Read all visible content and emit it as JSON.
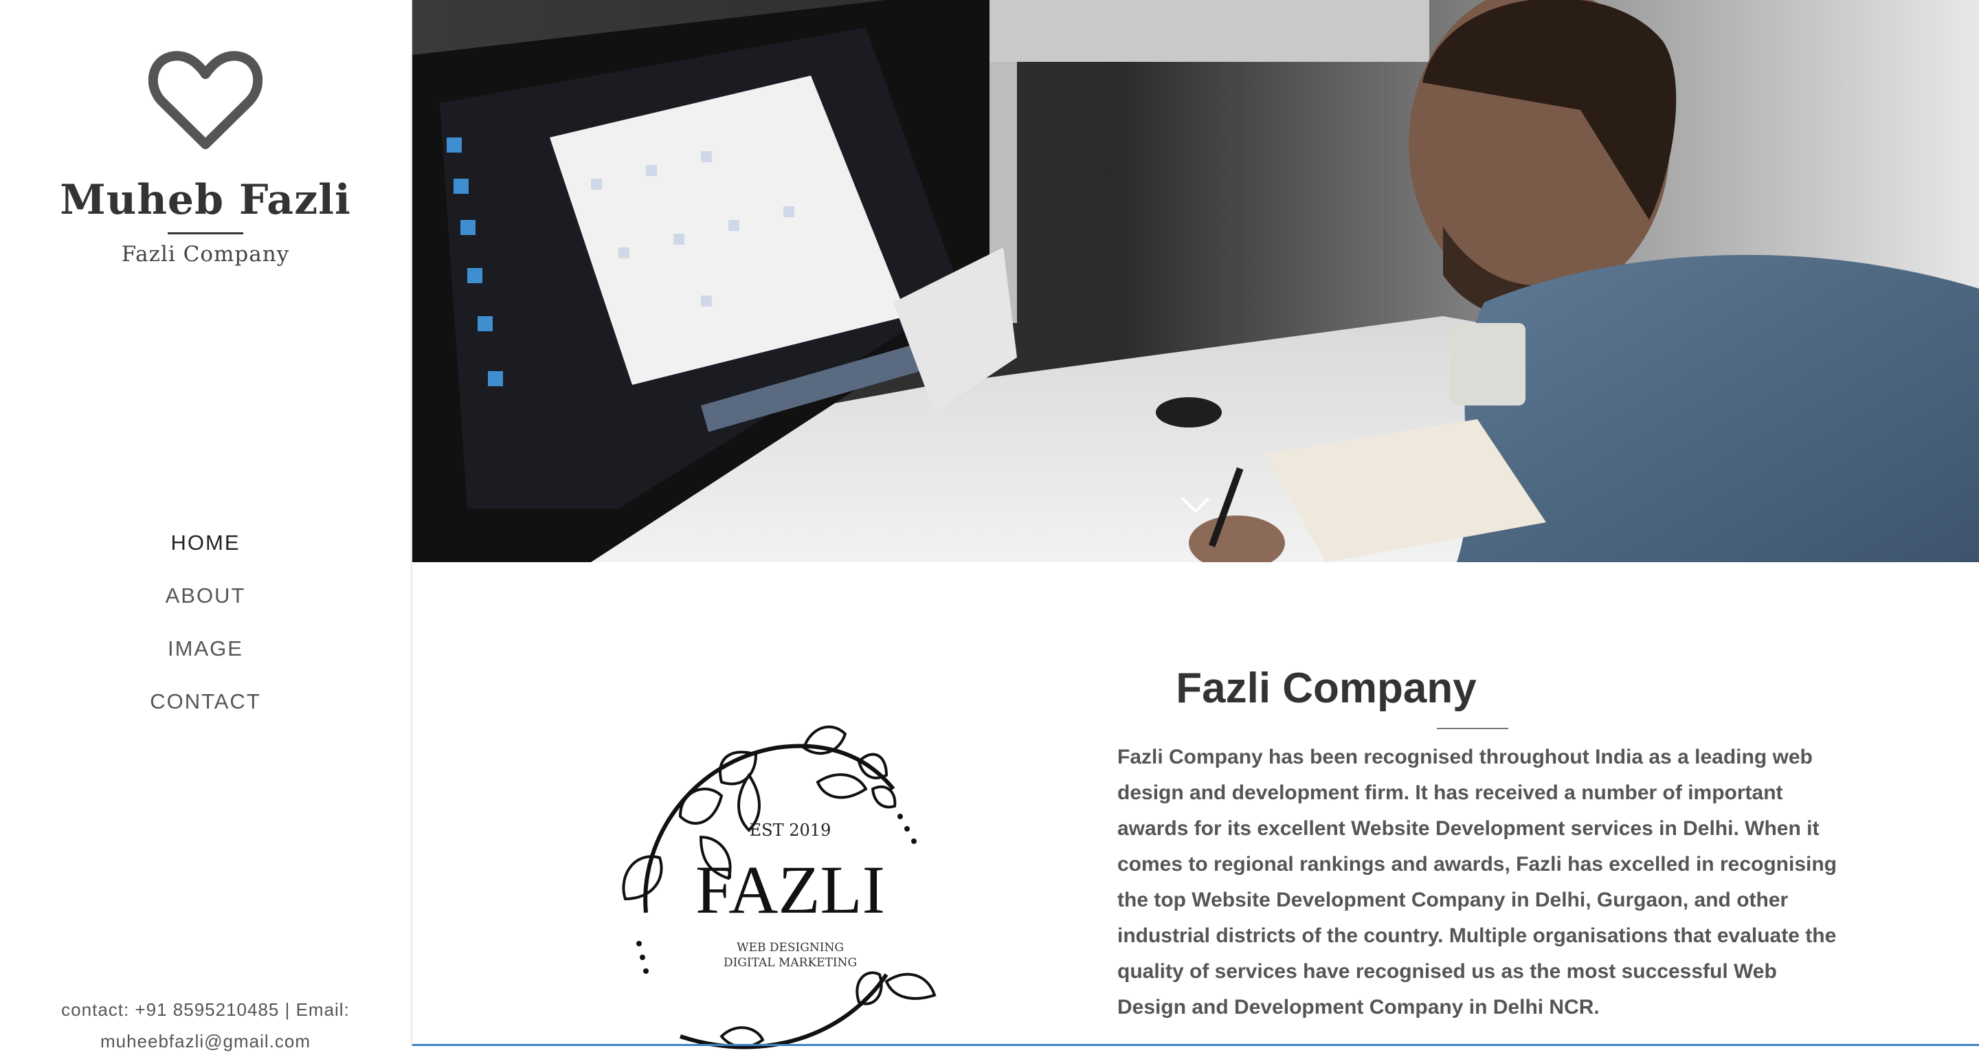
{
  "sidebar": {
    "logo_icon": "heart-icon",
    "site_title": "Muheb Fazli",
    "site_subtitle": "Fazli Company",
    "nav": [
      {
        "label": "HOME"
      },
      {
        "label": "ABOUT"
      },
      {
        "label": "IMAGE"
      },
      {
        "label": "CONTACT"
      }
    ],
    "footer_line1": "contact: +91 8595210485 | Email:",
    "footer_line2": "muheebfazli@gmail.com"
  },
  "hero": {
    "scroll_icon": "chevron-down-icon"
  },
  "about": {
    "title": "Fazli Company",
    "paragraph": "Fazli Company has been recognised throughout India as a leading web design and development firm. It has received a number of important awards for its excellent Website Development services in Delhi. When it comes to regional rankings and awards, Fazli has excelled in recognising the top Website Development Company in Delhi, Gurgaon, and other industrial districts of the country. Multiple organisations that evaluate the quality of services have recognised us as the most successful Web Design and Development Company in Delhi NCR.",
    "logo": {
      "est": "EST 2019",
      "name": "FAZLI",
      "line1": "WEB DESIGNING",
      "line2": "DIGITAL MARKETING"
    }
  },
  "colors": {
    "accent_line": "#3b82c4",
    "text_dark": "#333333",
    "text_body": "#555555"
  }
}
